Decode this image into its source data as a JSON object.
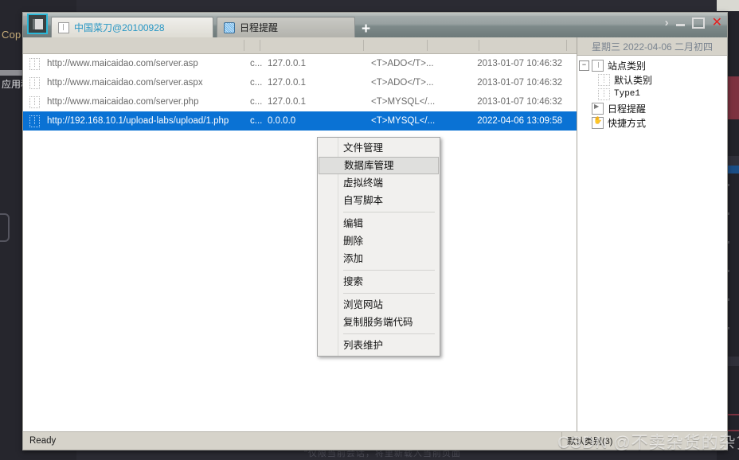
{
  "background": {
    "cop_text": "Cop",
    "app_text": "应用程",
    "bottom_text": "\"仅限当前会话，将里新载入当前页面"
  },
  "window": {
    "app_icon": "chopper-app-icon",
    "tabs": [
      {
        "label": "中国菜刀@20100928",
        "icon": "page-icon",
        "active": true
      },
      {
        "label": "日程提醒",
        "icon": "globe-icon",
        "active": false
      }
    ],
    "add_tab_label": "+",
    "controls": {
      "chevron": "›",
      "minimize": "minimize-icon",
      "maximize": "maximize-icon",
      "close": "✕"
    },
    "accent_color": "#2bb8d8",
    "close_color": "#e42222"
  },
  "list": {
    "columns": [
      "",
      "",
      "",
      "",
      "",
      ""
    ],
    "rows": [
      {
        "url": "http://www.maicaidao.com/server.asp",
        "enc": "c...",
        "ip": "127.0.0.1",
        "type": "<T>ADO</T>...",
        "date": "2013-01-07 10:46:32",
        "selected": false
      },
      {
        "url": "http://www.maicaidao.com/server.aspx",
        "enc": "c...",
        "ip": "127.0.0.1",
        "type": "<T>ADO</T>...",
        "date": "2013-01-07 10:46:32",
        "selected": false
      },
      {
        "url": "http://www.maicaidao.com/server.php",
        "enc": "c...",
        "ip": "127.0.0.1",
        "type": "<T>MYSQL</...",
        "date": "2013-01-07 10:46:32",
        "selected": false
      },
      {
        "url": "http://192.168.10.1/upload-labs/upload/1.php",
        "enc": "c...",
        "ip": "0.0.0.0",
        "type": "<T>MYSQL</...",
        "date": "2022-04-06 13:09:58",
        "selected": true
      }
    ],
    "selection_color": "#0a72d4"
  },
  "tree": {
    "date_header": "星期三  2022-04-06 二月初四",
    "nodes": [
      {
        "label": "站点类别",
        "level": 0,
        "expander": "−",
        "icon": "page-icon"
      },
      {
        "label": "默认类别",
        "level": 1,
        "icon": "category-icon"
      },
      {
        "label": "Type1",
        "level": 1,
        "icon": "category-icon",
        "mono": true
      },
      {
        "label": "日程提醒",
        "level": 0,
        "icon": "clock-icon"
      },
      {
        "label": "快捷方式",
        "level": 0,
        "icon": "hand-icon"
      }
    ]
  },
  "context_menu": {
    "groups": [
      {
        "items": [
          {
            "label": "文件管理",
            "highlighted": false
          },
          {
            "label": "数据库管理",
            "highlighted": true
          },
          {
            "label": "虚拟终端",
            "highlighted": false
          },
          {
            "label": "自写脚本",
            "highlighted": false
          }
        ]
      },
      {
        "items": [
          {
            "label": "编辑",
            "highlighted": false
          },
          {
            "label": "删除",
            "highlighted": false
          },
          {
            "label": "添加",
            "highlighted": false
          }
        ]
      },
      {
        "items": [
          {
            "label": "搜索",
            "highlighted": false
          }
        ]
      },
      {
        "items": [
          {
            "label": "浏览网站",
            "highlighted": false
          },
          {
            "label": "复制服务端代码",
            "highlighted": false
          }
        ]
      },
      {
        "items": [
          {
            "label": "列表维护",
            "highlighted": false
          }
        ]
      }
    ]
  },
  "statusbar": {
    "ready": "Ready",
    "category_count": "默认类别(3)"
  },
  "watermark": "CSDN @不卖杂货的杂货铺"
}
